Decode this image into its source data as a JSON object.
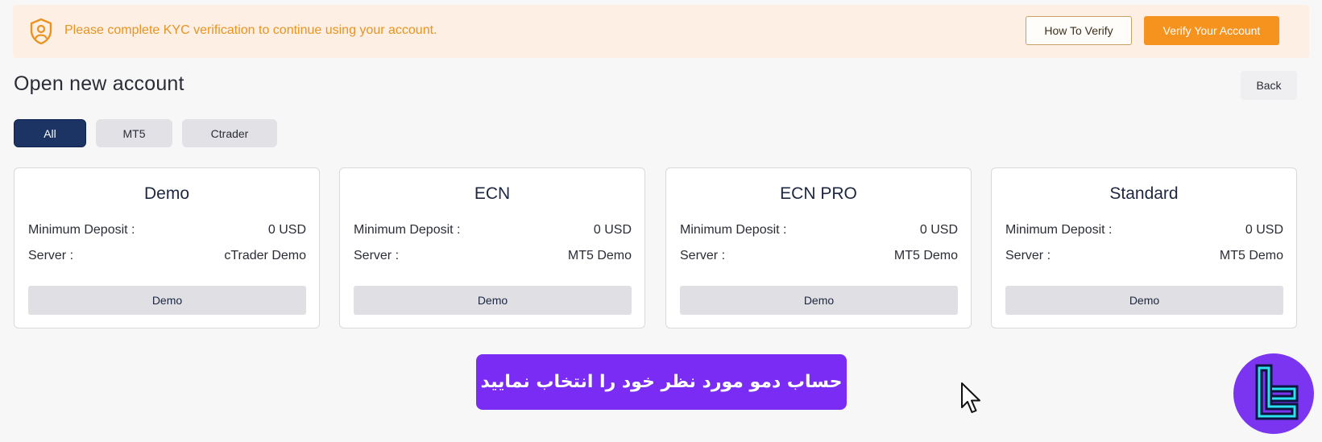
{
  "kyc_banner": {
    "message": "Please complete KYC verification to continue using your account.",
    "how_to_verify_label": "How To Verify",
    "verify_account_label": "Verify Your Account"
  },
  "header": {
    "title": "Open new account",
    "back_label": "Back"
  },
  "filters": {
    "tabs": [
      {
        "label": "All",
        "active": true
      },
      {
        "label": "MT5",
        "active": false
      },
      {
        "label": "Ctrader",
        "active": false
      }
    ]
  },
  "accounts": [
    {
      "name": "Demo",
      "deposit_label": "Minimum Deposit :",
      "deposit_value": "0 USD",
      "server_label": "Server :",
      "server_value": "cTrader Demo",
      "button_label": "Demo"
    },
    {
      "name": "ECN",
      "deposit_label": "Minimum Deposit :",
      "deposit_value": "0 USD",
      "server_label": "Server :",
      "server_value": "MT5 Demo",
      "button_label": "Demo"
    },
    {
      "name": "ECN PRO",
      "deposit_label": "Minimum Deposit :",
      "deposit_value": "0 USD",
      "server_label": "Server :",
      "server_value": "MT5 Demo",
      "button_label": "Demo"
    },
    {
      "name": "Standard",
      "deposit_label": "Minimum Deposit :",
      "deposit_value": "0 USD",
      "server_label": "Server :",
      "server_value": "MT5 Demo",
      "button_label": "Demo"
    }
  ],
  "overlay": {
    "caption": "حساب دمو مورد نظر خود را انتخاب نمایید"
  },
  "colors": {
    "banner_bg": "#fdefe3",
    "banner_text": "#e89422",
    "accent_orange": "#f6921e",
    "active_tab": "#1b3464",
    "caption_bg": "#7a2cf5"
  },
  "icons": {
    "kyc": "shield-user-icon",
    "cursor": "mouse-pointer-icon",
    "logo": "tradingfinder-logo"
  }
}
